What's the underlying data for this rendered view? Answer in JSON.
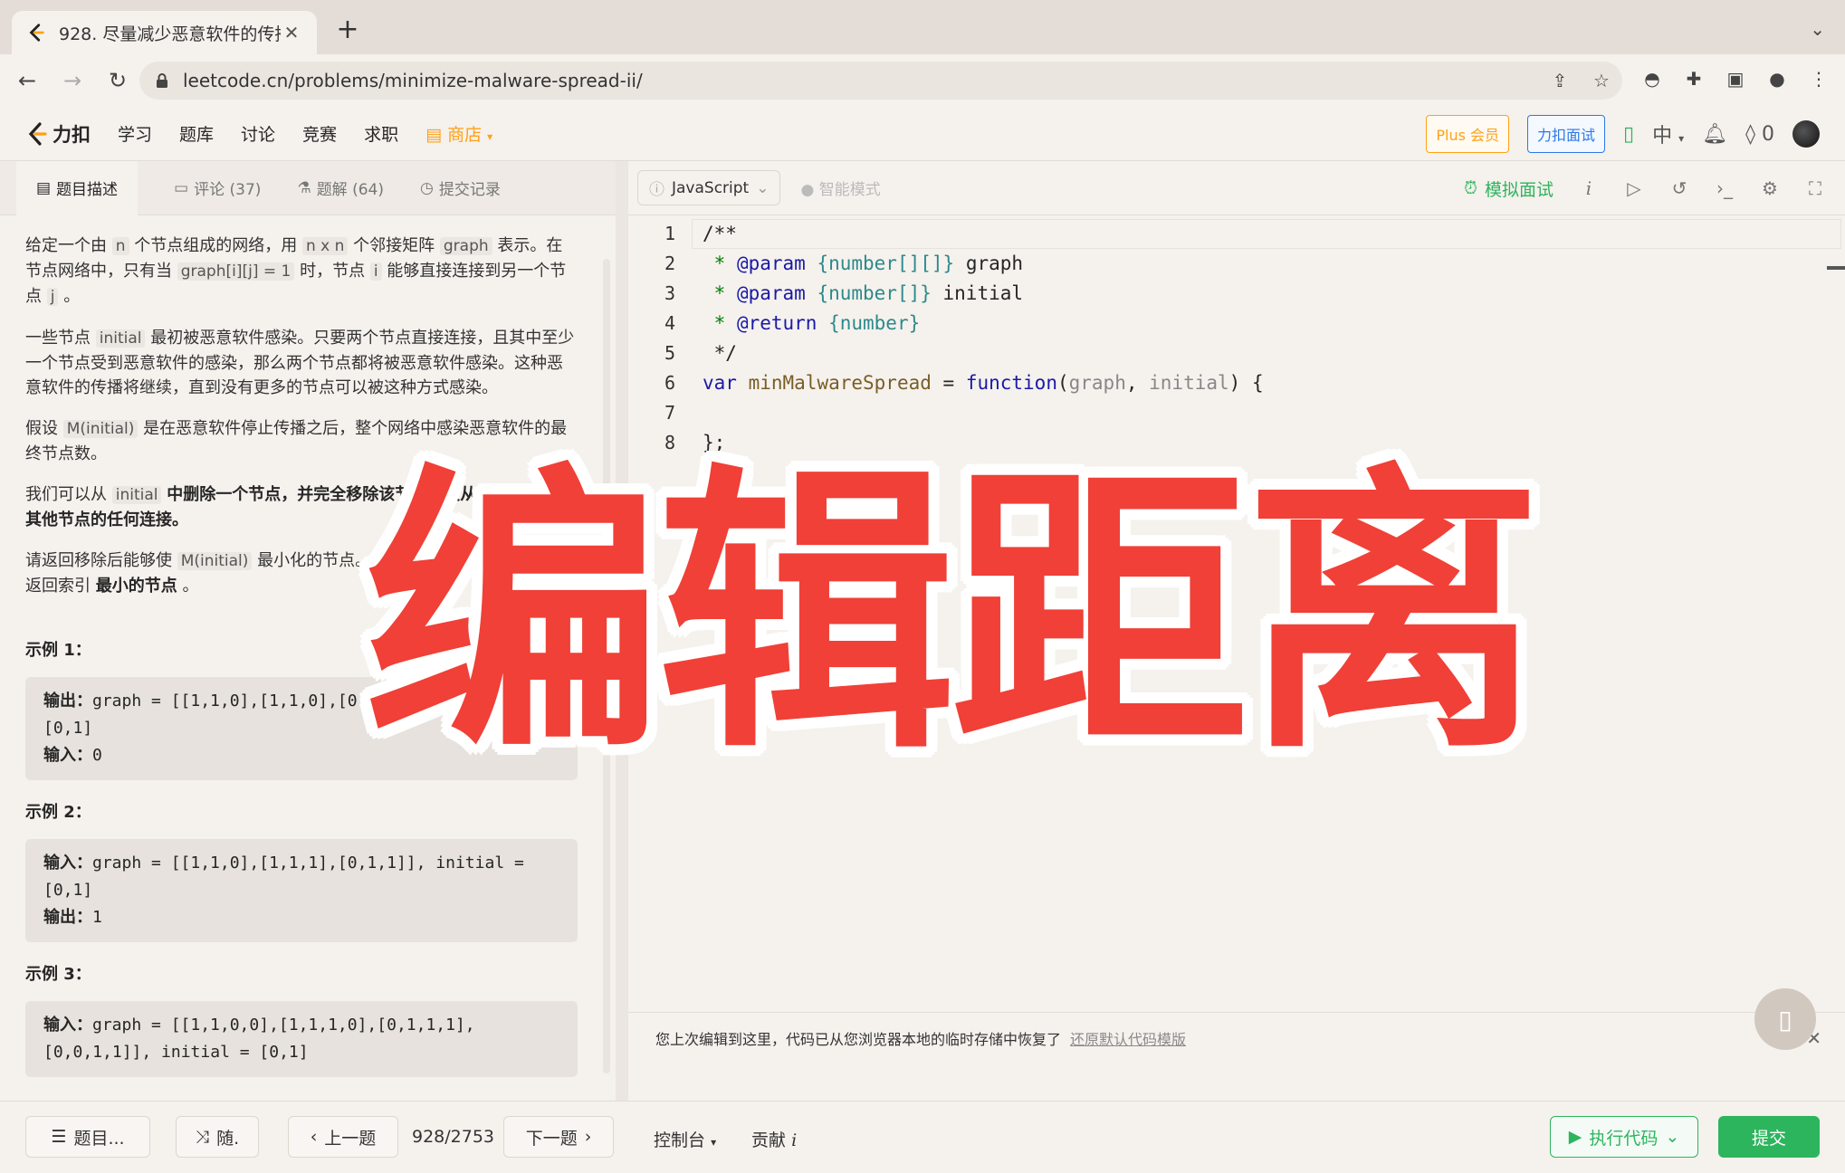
{
  "browser": {
    "tab_title": "928. 尽量减少恶意软件的传播 II",
    "new_tab": "+",
    "url": "leetcode.cn/problems/minimize-malware-spread-ii/"
  },
  "site": {
    "logo_text": "力扣",
    "nav": [
      "学习",
      "题库",
      "讨论",
      "竞赛",
      "求职"
    ],
    "store": "商店",
    "plus_label": "Plus 会员",
    "interview_label": "力扣面试",
    "lang_label": "中",
    "points": "0"
  },
  "left_tabs": {
    "description": "题目描述",
    "comments": "评论 (37)",
    "solutions": "题解 (64)",
    "submissions": "提交记录"
  },
  "description": {
    "p1_a": "给定一个由",
    "p1_n": "n",
    "p1_b": "个节点组成的网络，用",
    "p1_nxn": "n x n",
    "p1_c": "个邻接矩阵",
    "p1_graph": "graph",
    "p1_d": "表示。在节点网络中，只有当",
    "p1_cond": "graph[i][j] = 1",
    "p1_e": "时，节点",
    "p1_i": "i",
    "p1_f": "能够直接连接到另一个节点",
    "p1_j": "j",
    "p1_g": "。",
    "p2_a": "一些节点",
    "p2_initial": "initial",
    "p2_b": "最初被恶意软件感染。只要两个节点直接连接，且其中至少一个节点受到恶意软件的感染，那么两个节点都将被恶意软件感染。这种恶意软件的传播将继续，直到没有更多的节点可以被这种方式感染。",
    "p3_a": "假设",
    "p3_m": "M(initial)",
    "p3_b": "是在恶意软件停止传播之后，整个网络中感染恶意软件的最终节点数。",
    "p4_a": "我们可以从",
    "p4_initial": "initial",
    "p4_b": "中删除一个节点，并完全移除该节点以及从该节点到任何其他节点的任何连接。",
    "p5_a": "请返回移除后能够使",
    "p5_m": "M(initial)",
    "p5_b": "最小化的节点。如果有多个节点满足条件，返回索引",
    "p5_bold": "最小的节点",
    "p5_c": "。"
  },
  "examples": [
    {
      "title": "示例 1：",
      "line1_label": "输出：",
      "line1": "graph = [[1,1,0],[1,1,0],[0,0,1]], initial =",
      "line2": "[0,1]",
      "line3_label": "输入：",
      "line3": "0"
    },
    {
      "title": "示例 2：",
      "line1_label": "输入：",
      "line1": "graph = [[1,1,0],[1,1,1],[0,1,1]], initial =",
      "line2": "[0,1]",
      "line3_label": "输出：",
      "line3": "1"
    },
    {
      "title": "示例 3：",
      "line1_label": "输入：",
      "line1": "graph = [[1,1,0,0],[1,1,1,0],[0,1,1,1],",
      "line2": "[0,0,1,1]], initial = [0,1]"
    }
  ],
  "editor": {
    "language": "JavaScript",
    "smart_mode": "智能模式",
    "mock_interview": "模拟面试",
    "line_numbers": [
      "1",
      "2",
      "3",
      "4",
      "5",
      "6",
      "7",
      "8"
    ],
    "code": {
      "l1": "/**",
      "l2_star": " * ",
      "l2_tag": "@param",
      "l2_type": " {number[][]} ",
      "l2_name": "graph",
      "l3_star": " * ",
      "l3_tag": "@param",
      "l3_type": " {number[]} ",
      "l3_name": "initial",
      "l4_star": " * ",
      "l4_tag": "@return",
      "l4_type": " {number}",
      "l5": " */",
      "l6_var": "var",
      "l6_name": " minMalwareSpread",
      "l6_eq": " = ",
      "l6_fn": "function",
      "l6_open": "(",
      "l6_p1": "graph",
      "l6_comma": ", ",
      "l6_p2": "initial",
      "l6_close": ") {",
      "l7": "",
      "l8": "};"
    },
    "restore_msg": "您上次编辑到这里，代码已从您浏览器本地的临时存储中恢复了",
    "restore_link": "还原默认代码模版"
  },
  "bottom": {
    "problem_list": "题目...",
    "random": "随.",
    "prev": "上一题",
    "page": "928/2753",
    "next": "下一题",
    "console": "控制台",
    "contribute": "贡献",
    "run": "执行代码",
    "submit": "提交"
  },
  "overlay": {
    "title": "编辑距离"
  }
}
